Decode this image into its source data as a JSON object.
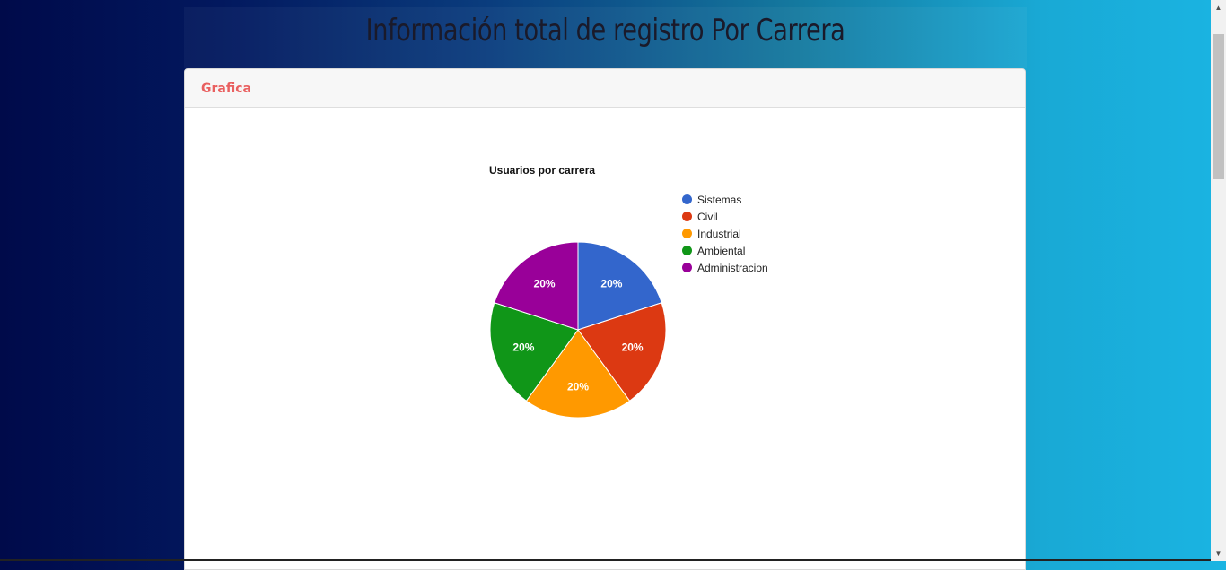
{
  "header": {
    "title": "Información total de registro Por Carrera"
  },
  "card": {
    "title": "Grafica"
  },
  "chart_data": {
    "type": "pie",
    "title": "Usuarios por carrera",
    "categories": [
      "Sistemas",
      "Civil",
      "Industrial",
      "Ambiental",
      "Administracion"
    ],
    "values": [
      20,
      20,
      20,
      20,
      20
    ],
    "labels": [
      "20%",
      "20%",
      "20%",
      "20%",
      "20%"
    ],
    "colors": [
      "#3366cc",
      "#dc3912",
      "#ff9900",
      "#109618",
      "#990099"
    ],
    "legend_position": "right"
  },
  "scrollbar": {
    "up_icon": "▲",
    "down_icon": "▼"
  }
}
